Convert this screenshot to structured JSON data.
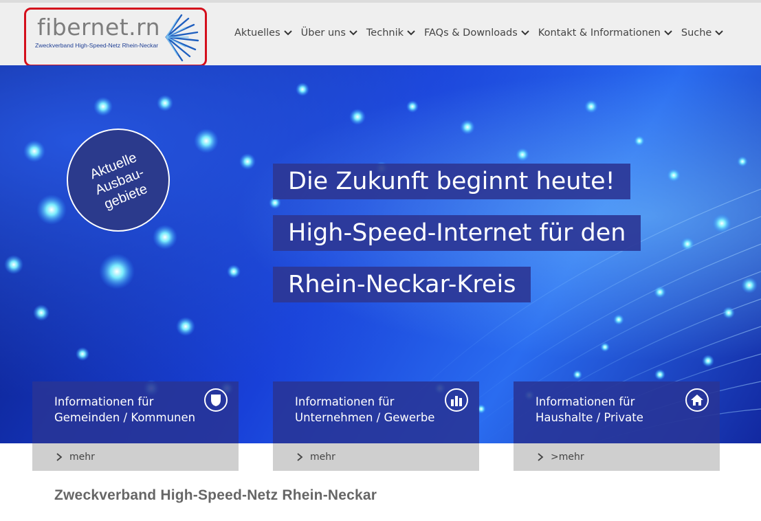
{
  "logo": {
    "text": "fibernet.rn",
    "subtitle": "Zweckverband High-Speed-Netz Rhein-Neckar"
  },
  "nav": {
    "items": [
      {
        "label": "Aktuelles"
      },
      {
        "label": "Über uns"
      },
      {
        "label": "Technik"
      },
      {
        "label": "FAQs & Downloads"
      },
      {
        "label": "Kontakt & Informationen"
      },
      {
        "label": "Suche"
      }
    ]
  },
  "badge": {
    "line1": "Aktuelle",
    "line2": "Ausbau-",
    "line3": "gebiete"
  },
  "hero": {
    "line1": "Die Zukunft beginnt heute!",
    "line2": "High-Speed-Internet für den",
    "line3": "Rhein-Neckar-Kreis"
  },
  "cards": [
    {
      "title_line1": "Informationen für",
      "title_line2": "Gemeinden / Kommunen",
      "more": "mehr",
      "icon": "shield-icon"
    },
    {
      "title_line1": "Informationen für",
      "title_line2": "Unternehmen / Gewerbe",
      "more": "mehr",
      "icon": "bar-chart-icon"
    },
    {
      "title_line1": "Informationen für",
      "title_line2": "Haushalte / Private",
      "more": ">mehr",
      "icon": "home-icon"
    }
  ],
  "footer": {
    "title": "Zweckverband High-Speed-Netz Rhein-Neckar"
  },
  "colors": {
    "accent_red": "#d40f1c",
    "brand_blue": "#1f3f94",
    "overlay_blue": "#2d3796"
  }
}
